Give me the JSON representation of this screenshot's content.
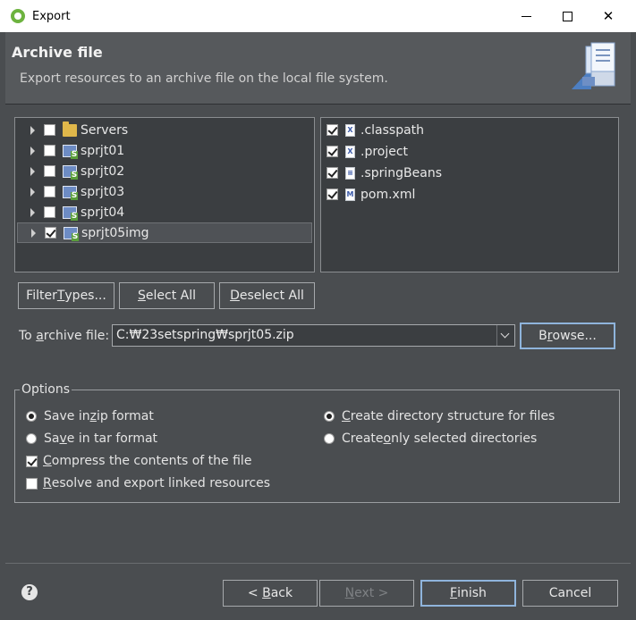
{
  "window": {
    "title": "Export",
    "minimize_glyph": "",
    "maximize_glyph": "",
    "close_glyph": "✕"
  },
  "banner": {
    "heading": "Archive file",
    "description": "Export resources to an archive file on the local file system."
  },
  "tree": {
    "items": [
      {
        "label": "Servers",
        "checked": false,
        "icon": "folder-icon"
      },
      {
        "label": "sprjt01",
        "checked": false,
        "icon": "spring-project-icon"
      },
      {
        "label": "sprjt02",
        "checked": false,
        "icon": "spring-project-icon"
      },
      {
        "label": "sprjt03",
        "checked": false,
        "icon": "spring-project-icon"
      },
      {
        "label": "sprjt04",
        "checked": false,
        "icon": "spring-project-icon"
      },
      {
        "label": "sprjt05img",
        "checked": true,
        "icon": "spring-project-icon"
      }
    ]
  },
  "files": {
    "items": [
      {
        "label": ".classpath",
        "checked": true,
        "badge": "X"
      },
      {
        "label": ".project",
        "checked": true,
        "badge": "X"
      },
      {
        "label": ".springBeans",
        "checked": true,
        "badge": "≡"
      },
      {
        "label": "pom.xml",
        "checked": true,
        "badge": "M"
      }
    ]
  },
  "buttons": {
    "filter_types": {
      "pre": "Filter ",
      "u": "T",
      "post": "ypes..."
    },
    "select_all": {
      "pre": "",
      "u": "S",
      "post": "elect All"
    },
    "deselect_all": {
      "pre": "",
      "u": "D",
      "post": "eselect All"
    },
    "browse": {
      "pre": "B",
      "u": "r",
      "post": "owse..."
    },
    "back": {
      "pre": "< ",
      "u": "B",
      "post": "ack"
    },
    "next": {
      "pre": "",
      "u": "N",
      "post": "ext >"
    },
    "finish": {
      "pre": "",
      "u": "F",
      "post": "inish"
    },
    "cancel": "Cancel"
  },
  "archive": {
    "label_pre": "To ",
    "label_u": "a",
    "label_post": "rchive file:",
    "value": "C:₩23setspring₩sprjt05.zip"
  },
  "options": {
    "title": "Options",
    "zip": {
      "pre": "Save in ",
      "u": "z",
      "post": "ip format",
      "selected": true
    },
    "tar": {
      "pre": "Sa",
      "u": "v",
      "post": "e in tar format",
      "selected": false
    },
    "compress": {
      "pre": "",
      "u": "C",
      "post": "ompress the contents of the file",
      "checked": true
    },
    "resolve": {
      "pre": "",
      "u": "R",
      "post": "esolve and export linked resources",
      "checked": false
    },
    "create_dir": {
      "pre": "",
      "u": "C",
      "post": "reate directory structure for files",
      "selected": true
    },
    "create_selected": {
      "pre": "Create ",
      "u": "o",
      "post": "nly selected directories",
      "selected": false
    }
  },
  "help_glyph": "?"
}
